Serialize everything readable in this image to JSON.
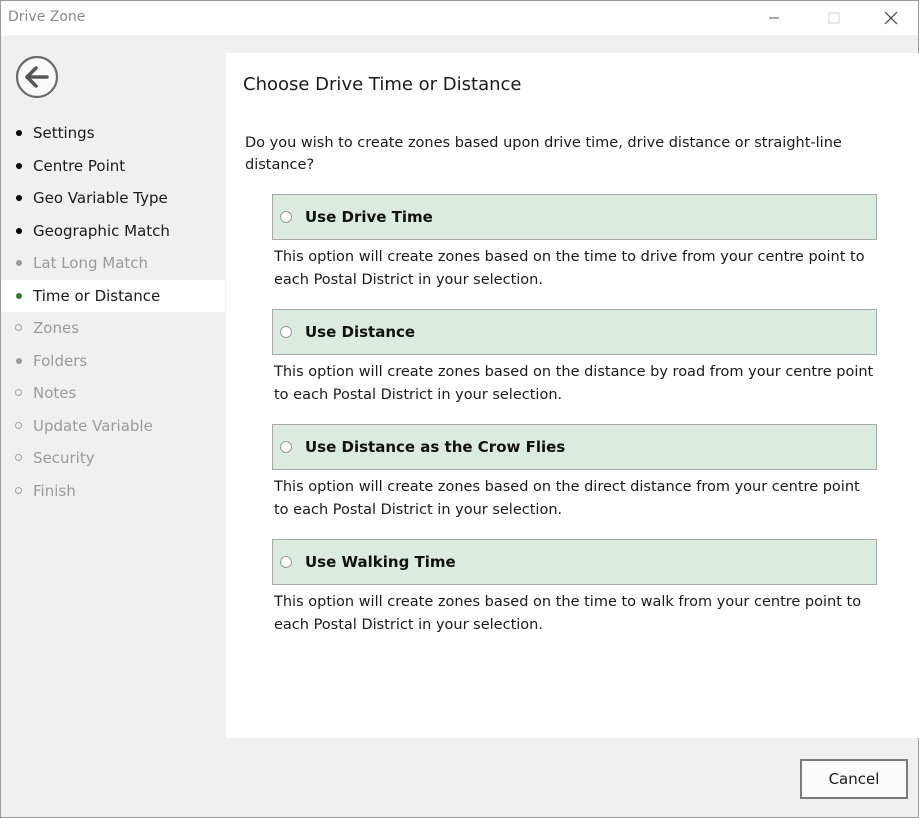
{
  "window": {
    "title": "Drive Zone"
  },
  "titlebar": {
    "minimize_icon": "minimize-icon",
    "maximize_icon": "maximize-icon",
    "close_icon": "close-icon"
  },
  "back_button": {
    "icon": "arrow-left-circle-icon"
  },
  "nav": {
    "items": [
      {
        "label": "Settings",
        "state": "done"
      },
      {
        "label": "Centre Point",
        "state": "done"
      },
      {
        "label": "Geo Variable Type",
        "state": "done"
      },
      {
        "label": "Geographic Match",
        "state": "done"
      },
      {
        "label": "Lat Long Match",
        "state": "skipped"
      },
      {
        "label": "Time or Distance",
        "state": "current"
      },
      {
        "label": "Zones",
        "state": "pending"
      },
      {
        "label": "Folders",
        "state": "skipped"
      },
      {
        "label": "Notes",
        "state": "pending"
      },
      {
        "label": "Update Variable",
        "state": "pending"
      },
      {
        "label": "Security",
        "state": "pending"
      },
      {
        "label": "Finish",
        "state": "pending"
      }
    ]
  },
  "main": {
    "heading": "Choose Drive Time or Distance",
    "question": "Do you wish to create zones based upon drive time, drive distance or straight-line distance?",
    "options": [
      {
        "label": "Use Drive Time",
        "description": "This option will create zones based on the time to drive from your centre point to each Postal District in your selection."
      },
      {
        "label": "Use Distance",
        "description": "This option will create zones based on the distance by road from your centre point to each Postal District in your selection."
      },
      {
        "label": "Use Distance as the Crow Flies",
        "description": "This option will create zones based on the direct distance from your centre point to each Postal District in your selection."
      },
      {
        "label": "Use Walking Time",
        "description": "This option will create zones based on the time to walk from your centre point to each Postal District in your selection."
      }
    ]
  },
  "footer": {
    "cancel_label": "Cancel"
  },
  "colors": {
    "option_bg": "#dcebe0",
    "current_bullet": "#2e7d32",
    "disabled_text": "#9a9a9a"
  }
}
